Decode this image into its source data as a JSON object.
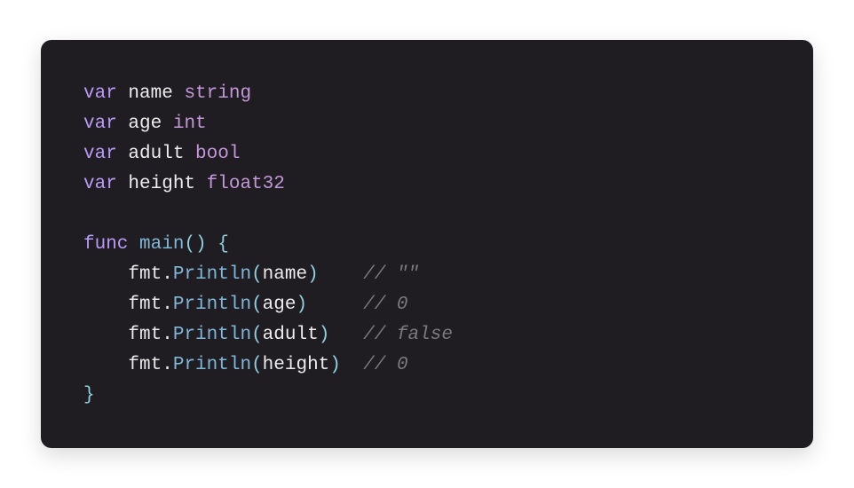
{
  "code": {
    "decls": [
      {
        "kw": "var",
        "name": "name",
        "type": "string"
      },
      {
        "kw": "var",
        "name": "age",
        "type": "int"
      },
      {
        "kw": "var",
        "name": "adult",
        "type": "bool"
      },
      {
        "kw": "var",
        "name": "height",
        "type": "float32"
      }
    ],
    "funcKeyword": "func",
    "funcName": "main",
    "parens": "()",
    "openBrace": " {",
    "closeBrace": "}",
    "body": [
      {
        "indent": "    ",
        "pkg": "fmt",
        "dot": ".",
        "method": "Println",
        "open": "(",
        "arg": "name",
        "close": ")",
        "gap": "    ",
        "commentPrefix": "// ",
        "commentValue": "\"\""
      },
      {
        "indent": "    ",
        "pkg": "fmt",
        "dot": ".",
        "method": "Println",
        "open": "(",
        "arg": "age",
        "close": ")",
        "gap": "     ",
        "commentPrefix": "// ",
        "commentValue": "0"
      },
      {
        "indent": "    ",
        "pkg": "fmt",
        "dot": ".",
        "method": "Println",
        "open": "(",
        "arg": "adult",
        "close": ")",
        "gap": "   ",
        "commentPrefix": "// ",
        "commentValue": "false"
      },
      {
        "indent": "    ",
        "pkg": "fmt",
        "dot": ".",
        "method": "Println",
        "open": "(",
        "arg": "height",
        "close": ")",
        "gap": "  ",
        "commentPrefix": "// ",
        "commentValue": "0"
      }
    ]
  }
}
